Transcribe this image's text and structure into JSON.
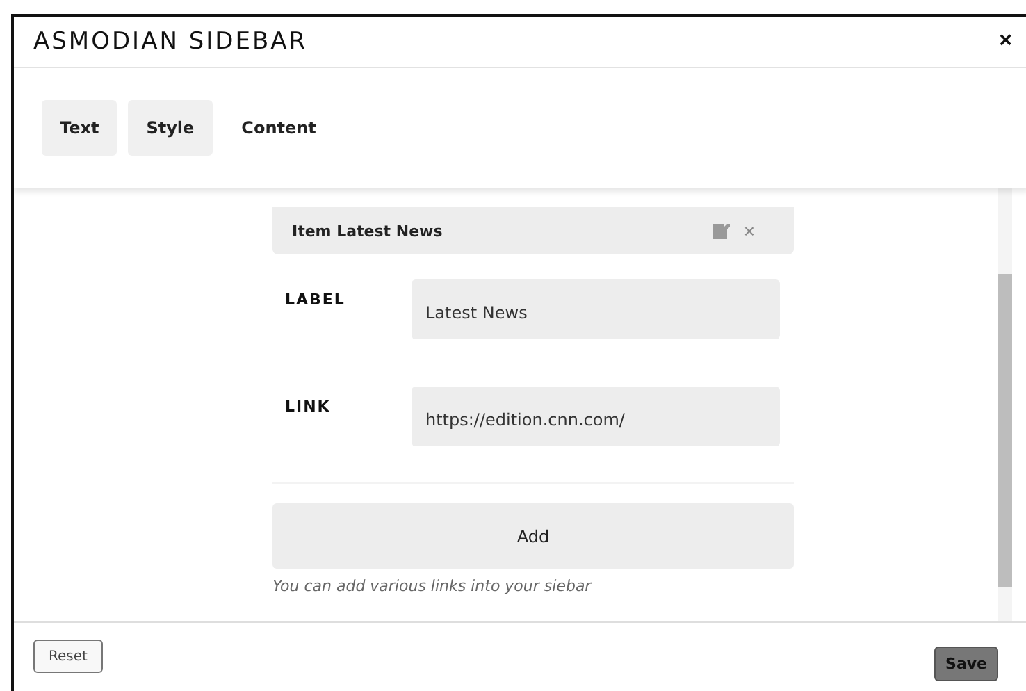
{
  "dialog": {
    "title": "ASMODIAN SIDEBAR",
    "close": "×"
  },
  "tabs": [
    {
      "label": "Text",
      "selected": false
    },
    {
      "label": "Style",
      "selected": false
    },
    {
      "label": "Content",
      "selected": true
    }
  ],
  "item": {
    "title": "Item Latest News",
    "remove": "×"
  },
  "fields": [
    {
      "label": "LABEL",
      "value": "Latest News"
    },
    {
      "label": "LINK",
      "value": "https://edition.cnn.com/"
    }
  ],
  "add_button": "Add",
  "hint": "You can add various links into your siebar",
  "footer": {
    "reset": "Reset",
    "save": "Save"
  }
}
